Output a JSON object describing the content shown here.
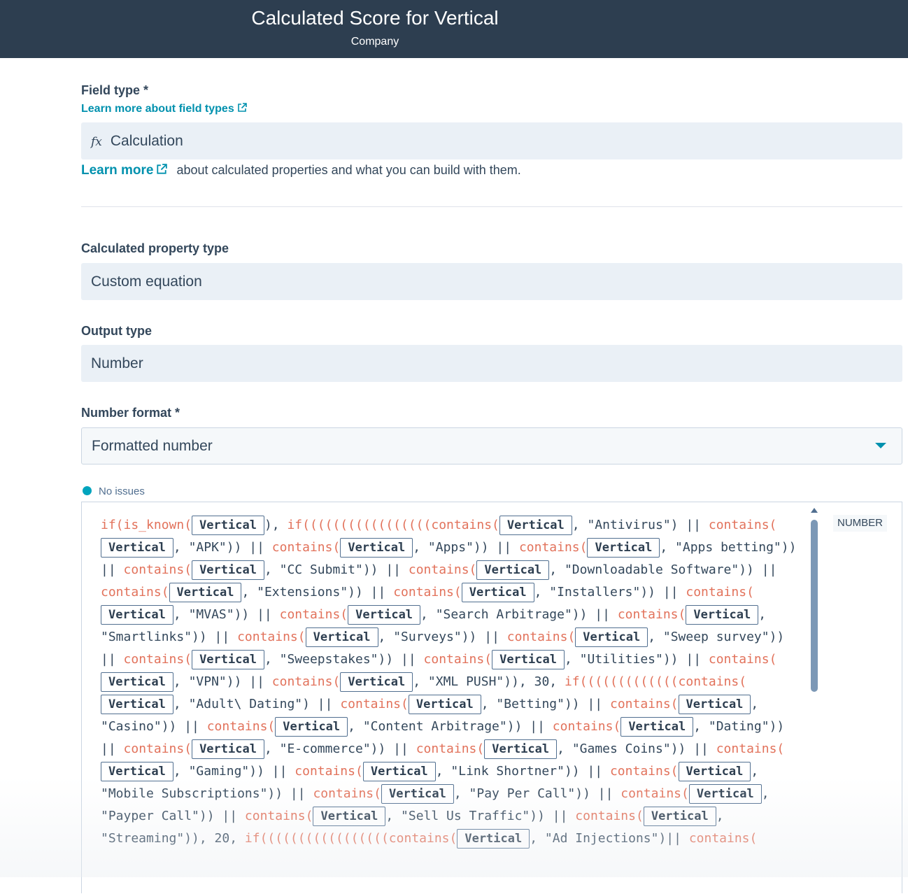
{
  "header": {
    "title": "Calculated Score for Vertical",
    "subtitle": "Company"
  },
  "field_type": {
    "label": "Field type *",
    "learn_link": "Learn more about field types",
    "value": "Calculation",
    "value_icon": "fx-icon",
    "helper_link": "Learn more",
    "helper_text": "about calculated properties and what you can build with them."
  },
  "calc_type": {
    "label": "Calculated property type",
    "value": "Custom equation"
  },
  "output_type": {
    "label": "Output type",
    "value": "Number"
  },
  "number_format": {
    "label": "Number format *",
    "value": "Formatted number"
  },
  "editor": {
    "status": "No issues",
    "type_badge": "NUMBER",
    "segments": [
      {
        "t": "k",
        "v": "if(is_known("
      },
      {
        "t": "p",
        "v": "Vertical"
      },
      {
        "t": "s",
        "v": "), "
      },
      {
        "t": "k",
        "v": "if(((((((((((((((((contains("
      },
      {
        "t": "p",
        "v": "Vertical"
      },
      {
        "t": "s",
        "v": ", \"Antivirus\") || "
      },
      {
        "t": "k",
        "v": "contains("
      },
      {
        "t": "p",
        "v": "Vertical"
      },
      {
        "t": "s",
        "v": ", \"APK\")) || "
      },
      {
        "t": "k",
        "v": "contains("
      },
      {
        "t": "p",
        "v": "Vertical"
      },
      {
        "t": "s",
        "v": ", \"Apps\")) || "
      },
      {
        "t": "k",
        "v": "contains("
      },
      {
        "t": "p",
        "v": "Vertical"
      },
      {
        "t": "s",
        "v": ", \"Apps betting\")) || "
      },
      {
        "t": "k",
        "v": "contains("
      },
      {
        "t": "p",
        "v": "Vertical"
      },
      {
        "t": "s",
        "v": ", \"CC Submit\")) || "
      },
      {
        "t": "k",
        "v": "contains("
      },
      {
        "t": "p",
        "v": "Vertical"
      },
      {
        "t": "s",
        "v": ", \"Downloadable Software\")) || "
      },
      {
        "t": "k",
        "v": "contains("
      },
      {
        "t": "p",
        "v": "Vertical"
      },
      {
        "t": "s",
        "v": ", \"Extensions\")) || "
      },
      {
        "t": "k",
        "v": "contains("
      },
      {
        "t": "p",
        "v": "Vertical"
      },
      {
        "t": "s",
        "v": ", \"Installers\")) || "
      },
      {
        "t": "k",
        "v": "contains("
      },
      {
        "t": "p",
        "v": "Vertical"
      },
      {
        "t": "s",
        "v": ", \"MVAS\")) || "
      },
      {
        "t": "k",
        "v": "contains("
      },
      {
        "t": "p",
        "v": "Vertical"
      },
      {
        "t": "s",
        "v": ", \"Search Arbitrage\")) || "
      },
      {
        "t": "k",
        "v": "contains("
      },
      {
        "t": "p",
        "v": "Vertical"
      },
      {
        "t": "s",
        "v": ", \"Smartlinks\")) || "
      },
      {
        "t": "k",
        "v": "contains("
      },
      {
        "t": "p",
        "v": "Vertical"
      },
      {
        "t": "s",
        "v": ", \"Surveys\")) || "
      },
      {
        "t": "k",
        "v": "contains("
      },
      {
        "t": "p",
        "v": "Vertical"
      },
      {
        "t": "s",
        "v": ", \"Sweep survey\")) || "
      },
      {
        "t": "k",
        "v": "contains("
      },
      {
        "t": "p",
        "v": "Vertical"
      },
      {
        "t": "s",
        "v": ", \"Sweepstakes\")) || "
      },
      {
        "t": "k",
        "v": "contains("
      },
      {
        "t": "p",
        "v": "Vertical"
      },
      {
        "t": "s",
        "v": ", \"Utilities\")) || "
      },
      {
        "t": "k",
        "v": "contains("
      },
      {
        "t": "p",
        "v": "Vertical"
      },
      {
        "t": "s",
        "v": ", \"VPN\")) || "
      },
      {
        "t": "k",
        "v": "contains("
      },
      {
        "t": "p",
        "v": "Vertical"
      },
      {
        "t": "s",
        "v": ", \"XML PUSH\")), 30, "
      },
      {
        "t": "k",
        "v": "if(((((((((((((contains("
      },
      {
        "t": "p",
        "v": "Vertical"
      },
      {
        "t": "s",
        "v": ", \"Adult\\ Dating\") || "
      },
      {
        "t": "k",
        "v": "contains("
      },
      {
        "t": "p",
        "v": "Vertical"
      },
      {
        "t": "s",
        "v": ", \"Betting\")) || "
      },
      {
        "t": "k",
        "v": "contains("
      },
      {
        "t": "p",
        "v": "Vertical"
      },
      {
        "t": "s",
        "v": ", \"Casino\")) || "
      },
      {
        "t": "k",
        "v": "contains("
      },
      {
        "t": "p",
        "v": "Vertical"
      },
      {
        "t": "s",
        "v": ", \"Content Arbitrage\")) || "
      },
      {
        "t": "k",
        "v": "contains("
      },
      {
        "t": "p",
        "v": "Vertical"
      },
      {
        "t": "s",
        "v": ", \"Dating\")) || "
      },
      {
        "t": "k",
        "v": "contains("
      },
      {
        "t": "p",
        "v": "Vertical"
      },
      {
        "t": "s",
        "v": ", \"E-commerce\")) || "
      },
      {
        "t": "k",
        "v": "contains("
      },
      {
        "t": "p",
        "v": "Vertical"
      },
      {
        "t": "s",
        "v": ", \"Games Coins\")) || "
      },
      {
        "t": "k",
        "v": "contains("
      },
      {
        "t": "p",
        "v": "Vertical"
      },
      {
        "t": "s",
        "v": ", \"Gaming\")) || "
      },
      {
        "t": "k",
        "v": "contains("
      },
      {
        "t": "p",
        "v": "Vertical"
      },
      {
        "t": "s",
        "v": ", \"Link Shortner\")) || "
      },
      {
        "t": "k",
        "v": "contains("
      },
      {
        "t": "p",
        "v": "Vertical"
      },
      {
        "t": "s",
        "v": ", \"Mobile Subscriptions\")) || "
      },
      {
        "t": "k",
        "v": "contains("
      },
      {
        "t": "p",
        "v": "Vertical"
      },
      {
        "t": "s",
        "v": ", \"Pay Per Call\")) || "
      },
      {
        "t": "k",
        "v": "contains("
      },
      {
        "t": "p",
        "v": "Vertical"
      },
      {
        "t": "s",
        "v": ", \"Payper Call\")) || "
      },
      {
        "t": "k",
        "v": "contains("
      },
      {
        "t": "p",
        "v": "Vertical"
      },
      {
        "t": "s",
        "v": ", \"Sell Us Traffic\")) || "
      },
      {
        "t": "k",
        "v": "contains("
      },
      {
        "t": "p",
        "v": "Vertical"
      },
      {
        "t": "s",
        "v": ", \"Streaming\")), 20, "
      },
      {
        "t": "k",
        "v": "if(((((((((((((((((contains("
      },
      {
        "t": "p",
        "v": "Vertical"
      },
      {
        "t": "s",
        "v": ", \"Ad Injections\")|| "
      },
      {
        "t": "k",
        "v": "contains("
      }
    ]
  },
  "colors": {
    "header_bg": "#2d3e50",
    "link": "#0091ae",
    "keyword": "#e2725b",
    "field_bg": "#eaf0f6",
    "status_dot": "#00a4bd"
  }
}
